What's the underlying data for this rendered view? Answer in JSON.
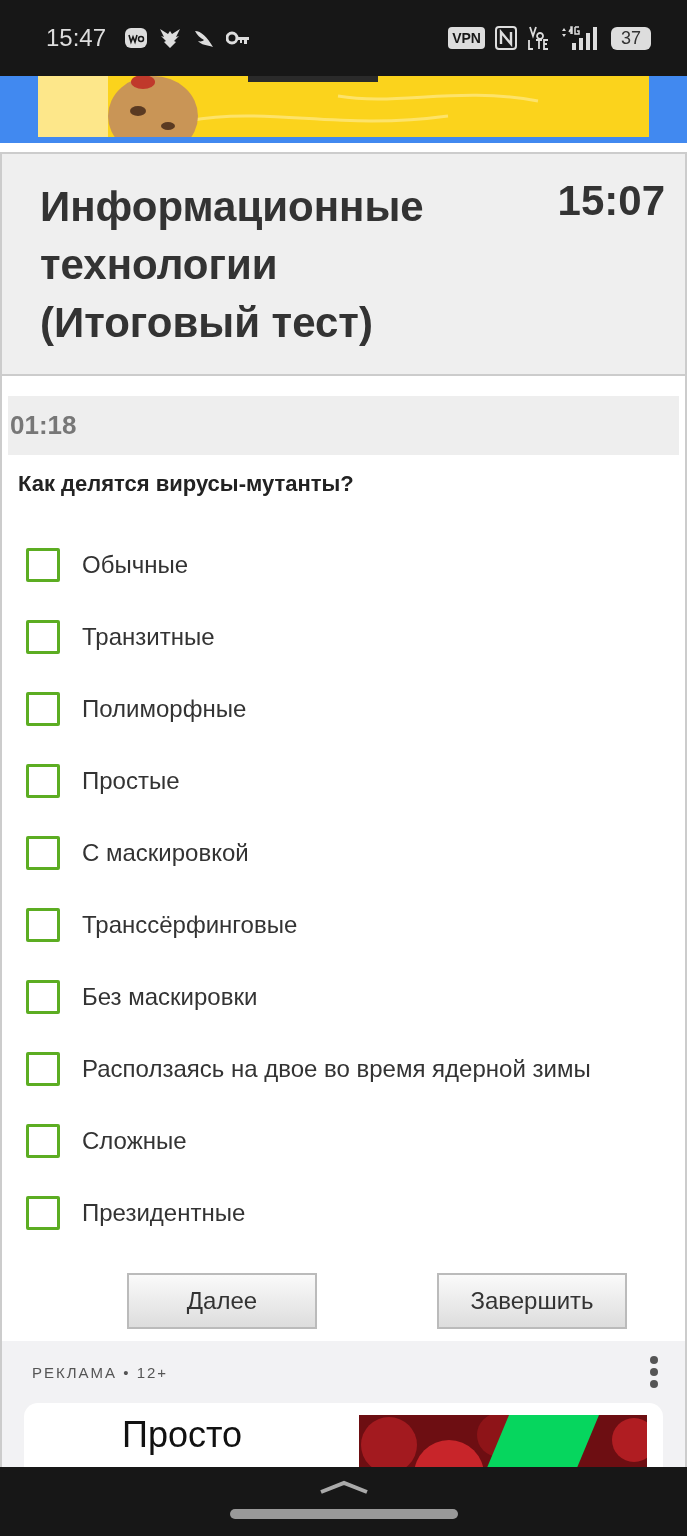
{
  "status_bar": {
    "time": "15:47",
    "vpn": "VPN",
    "battery": "37"
  },
  "test": {
    "title": "Информационные технологии (Итоговый тест)",
    "clock": "15:07",
    "timer": "01:18",
    "question": "Как делятся вирусы-мутанты?",
    "options": [
      {
        "label": "Обычные",
        "checked": false
      },
      {
        "label": "Транзитные",
        "checked": false
      },
      {
        "label": "Полиморфные",
        "checked": false
      },
      {
        "label": "Простые",
        "checked": false
      },
      {
        "label": "С маскировкой",
        "checked": false
      },
      {
        "label": "Транссёрфинговые",
        "checked": false
      },
      {
        "label": "Без маскировки",
        "checked": false
      },
      {
        "label": "Расползаясь на двое во время ядерной зимы",
        "checked": false
      },
      {
        "label": "Сложные",
        "checked": false
      },
      {
        "label": "Президентные",
        "checked": false
      }
    ],
    "buttons": [
      "Далее",
      "Завершить"
    ]
  },
  "ad": {
    "label": "РЕКЛАМА • 12+",
    "headline": "Просто"
  }
}
